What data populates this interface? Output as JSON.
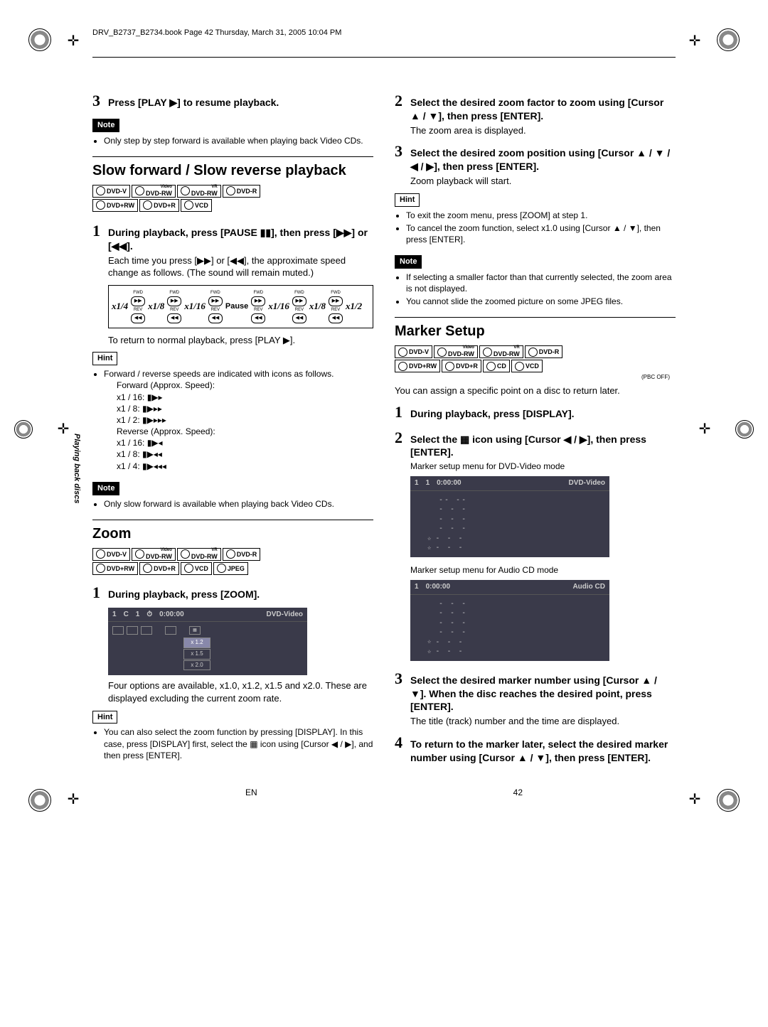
{
  "header": "DRV_B2737_B2734.book  Page 42  Thursday, March 31, 2005  10:04 PM",
  "side_tab": "Playing back discs",
  "labels": {
    "note": "Note",
    "hint": "Hint"
  },
  "left": {
    "step3": "Press [PLAY ▶] to resume playback.",
    "note1": "Only step by step forward is available when playing back Video CDs.",
    "slow_title": "Slow forward / Slow reverse playback",
    "slow_discs1": [
      "DVD-V",
      "DVD-RW",
      "DVD-RW",
      "DVD-R"
    ],
    "slow_discs1_sup": [
      "",
      "Video",
      "VR",
      ""
    ],
    "slow_discs2": [
      "DVD+RW",
      "DVD+R",
      "VCD"
    ],
    "slow_step1": "During playback, press [PAUSE ▮▮], then press [▶▶] or [◀◀].",
    "slow_step1_body": "Each time you press [▶▶] or [◀◀], the approximate speed change as follows. (The sound will remain muted.)",
    "speed": {
      "left": [
        "x1/4",
        "x1/8",
        "x1/16"
      ],
      "mid": "Pause",
      "right": [
        "x1/16",
        "x1/8",
        "x1/2"
      ],
      "btn_fwd": "FWD",
      "btn_rev": "REV"
    },
    "slow_return": "To return to normal playback, press [PLAY ▶].",
    "slow_hint_intro": "Forward / reverse speeds are indicated with icons as follows.",
    "fwd_label": "Forward (Approx. Speed):",
    "fwd_speeds": [
      "x1 / 16: ▮▶▸",
      "x1 / 8:  ▮▶▸▸",
      "x1 / 2:  ▮▶▸▸▸"
    ],
    "rev_label": "Reverse (Approx. Speed):",
    "rev_speeds": [
      "x1 / 16: ▮▶◂",
      "x1 / 8:  ▮▶◂◂",
      "x1 / 4:  ▮▶◂◂◂"
    ],
    "slow_note2": "Only slow forward is available when playing back Video CDs.",
    "zoom_title": "Zoom",
    "zoom_discs1": [
      "DVD-V",
      "DVD-RW",
      "DVD-RW",
      "DVD-R"
    ],
    "zoom_discs1_sup": [
      "",
      "Video",
      "VR",
      ""
    ],
    "zoom_discs2": [
      "DVD+RW",
      "DVD+R",
      "VCD",
      "JPEG"
    ],
    "zoom_step1": "During playback, press [ZOOM].",
    "zoom_osd": {
      "row": [
        "1",
        "C",
        "1",
        "⏱",
        "0:00:00"
      ],
      "mode": "DVD-Video",
      "opts": [
        "x 1.2",
        "x 1.5",
        "x 2.0"
      ]
    },
    "zoom_step1_body": "Four options are available, x1.0, x1.2, x1.5 and x2.0. These are displayed excluding the current zoom rate.",
    "zoom_hint": "You can also select the zoom function by pressing [DISPLAY]. In this case, press [DISPLAY] first, select the ▦ icon using [Cursor ◀ / ▶], and then press [ENTER]."
  },
  "right": {
    "step2": "Select the desired zoom factor to zoom using [Cursor ▲ / ▼], then press [ENTER].",
    "step2_body": "The zoom area is displayed.",
    "step3": "Select the desired zoom position using [Cursor ▲ / ▼ / ◀ / ▶], then press [ENTER].",
    "step3_body": "Zoom playback will start.",
    "hint_items": [
      "To exit the zoom menu, press [ZOOM] at step 1.",
      "To cancel the zoom function, select x1.0 using [Cursor ▲ / ▼], then press [ENTER]."
    ],
    "note_items": [
      "If selecting a smaller factor than that currently selected, the zoom area is not displayed.",
      "You cannot slide the zoomed picture on some JPEG files."
    ],
    "marker_title": "Marker Setup",
    "marker_discs1": [
      "DVD-V",
      "DVD-RW",
      "DVD-RW",
      "DVD-R"
    ],
    "marker_discs1_sup": [
      "",
      "Video",
      "VR",
      ""
    ],
    "marker_discs2": [
      "DVD+RW",
      "DVD+R",
      "CD",
      "VCD"
    ],
    "pbc_off": "(PBC OFF)",
    "marker_intro": "You can assign a specific point on a disc to return later.",
    "marker_step1": "During playback, press [DISPLAY].",
    "marker_step2": "Select the ▦ icon using [Cursor ◀ / ▶], then press [ENTER].",
    "marker_caption_dvd": "Marker setup menu for DVD-Video mode",
    "marker_osd_dvd": {
      "row": [
        "1",
        "1",
        "0:00:00"
      ],
      "mode": "DVD-Video"
    },
    "marker_caption_cd": "Marker setup menu for Audio CD mode",
    "marker_osd_cd": {
      "row": [
        "1",
        "0:00:00"
      ],
      "mode": "Audio CD"
    },
    "marker_step3": "Select the desired marker number using [Cursor ▲ / ▼]. When the disc reaches the desired point, press [ENTER].",
    "marker_step3_body": "The title (track) number and the time are displayed.",
    "marker_step4": "To return to the marker later, select the desired marker number using [Cursor ▲ / ▼], then press [ENTER]."
  },
  "footer": {
    "lang": "EN",
    "page": "42"
  }
}
